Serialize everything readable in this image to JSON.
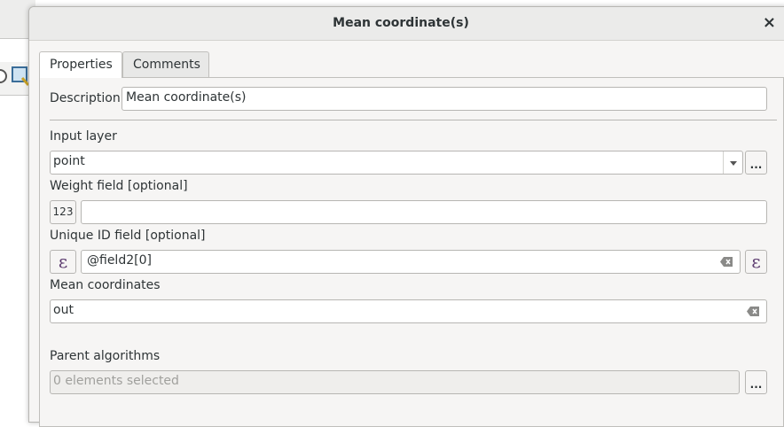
{
  "dialog": {
    "title": "Mean coordinate(s)",
    "close_glyph": "×"
  },
  "tabs": [
    {
      "label": "Properties",
      "active": true
    },
    {
      "label": "Comments",
      "active": false
    }
  ],
  "form": {
    "description_label": "Description",
    "description_value": "Mean coordinate(s)",
    "input_layer_label": "Input layer",
    "input_layer_value": "point",
    "browse_label": "...",
    "weight_field_label": "Weight field [optional]",
    "weight_field_type": "123",
    "weight_field_value": "",
    "unique_id_label": "Unique ID field [optional]",
    "unique_id_value": "@field2[0]",
    "mean_coordinates_label": "Mean coordinates",
    "mean_coordinates_value": "out",
    "parent_algorithms_label": "Parent algorithms",
    "parent_algorithms_placeholder": "0 elements selected"
  },
  "icons": {
    "expression_glyph": "ε",
    "clear": "clear-text-icon",
    "dropdown": "chevron-down-icon"
  },
  "colors": {
    "expression_accent": "#5b3a6e"
  }
}
